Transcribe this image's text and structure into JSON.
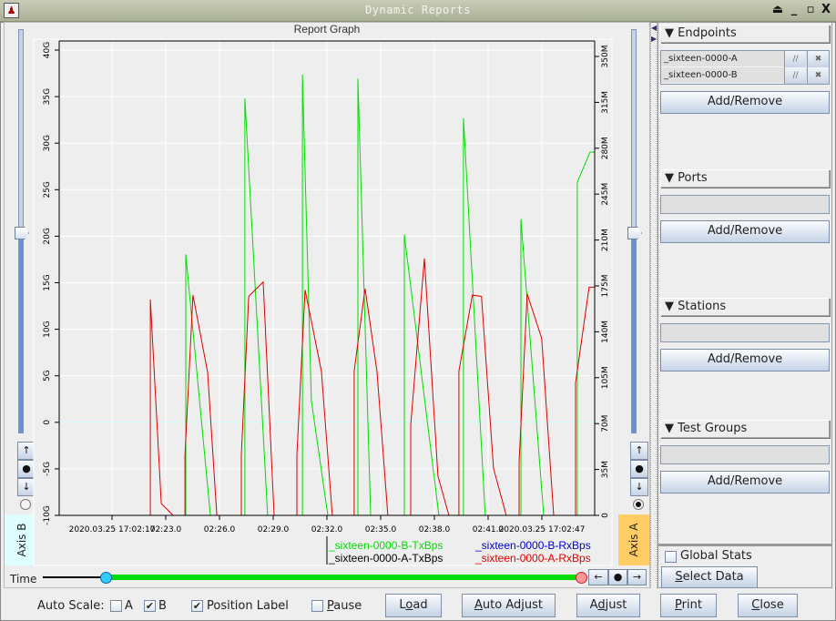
{
  "window": {
    "title": "Dynamic Reports"
  },
  "graph": {
    "title": "Report Graph",
    "axis_b_label": "Axis B",
    "axis_a_label": "Axis A",
    "axis_b_slider_value": 0.625,
    "axis_a_slider_value": 0.51,
    "axis_b_radio_selected": false,
    "axis_a_radio_selected": true,
    "scroll_up": "↑",
    "scroll_center": "●",
    "scroll_down": "↓"
  },
  "chart_data": {
    "type": "line",
    "title": "Report Graph",
    "xlabel": "",
    "left_axis": {
      "name": "Axis B",
      "ticks": [
        "-10G",
        "-5G",
        "0",
        "5G",
        "10G",
        "15G",
        "20G",
        "25G",
        "30G",
        "35G",
        "40G"
      ],
      "ylim": [
        -10,
        40
      ],
      "unit": "G"
    },
    "right_axis": {
      "name": "Axis A",
      "ticks": [
        "0",
        "35M",
        "70M",
        "105M",
        "140M",
        "175M",
        "210M",
        "245M",
        "280M",
        "315M",
        "350M"
      ],
      "ylim": [
        0,
        350
      ],
      "unit": "M"
    },
    "x_ticks": [
      {
        "t": 20,
        "label": "2020.03.25 17:02:17"
      },
      {
        "t": 23,
        "label": "02:23.0"
      },
      {
        "t": 26,
        "label": "02:26.0"
      },
      {
        "t": 29,
        "label": "02:29.0"
      },
      {
        "t": 32,
        "label": "02:32.0"
      },
      {
        "t": 35,
        "label": "02:35.0"
      },
      {
        "t": 38,
        "label": "02:38.0"
      },
      {
        "t": 41,
        "label": "02:41.0"
      },
      {
        "t": 44,
        "label": "2020.03.25 17:02:47"
      }
    ],
    "xlim": [
      17.05,
      46.95
    ],
    "grid": true,
    "legend_position": "bottom-right",
    "series": [
      {
        "name": "_sixteen-0000-B-TxBps",
        "color": "#00dd00",
        "axis": "right",
        "points": [
          [
            24.12,
            0
          ],
          [
            24.12,
            199
          ],
          [
            25.49,
            0
          ],
          [
            27.42,
            0
          ],
          [
            27.42,
            318
          ],
          [
            28.69,
            0
          ],
          [
            30.63,
            0
          ],
          [
            30.63,
            336
          ],
          [
            31.13,
            87.5
          ],
          [
            32.05,
            0
          ],
          [
            33.73,
            0
          ],
          [
            33.73,
            333
          ],
          [
            34.44,
            0
          ],
          [
            36.32,
            0
          ],
          [
            36.32,
            214
          ],
          [
            38.25,
            0
          ],
          [
            39.62,
            0
          ],
          [
            39.62,
            303
          ],
          [
            40.84,
            0
          ],
          [
            42.83,
            0
          ],
          [
            42.83,
            226
          ],
          [
            44.1,
            0
          ],
          [
            45.98,
            0
          ],
          [
            45.98,
            254
          ],
          [
            46.69,
            277
          ],
          [
            46.95,
            277
          ]
        ]
      },
      {
        "name": "_sixteen-0000-B-RxBps",
        "color": "#0000cc",
        "axis": "right",
        "points": []
      },
      {
        "name": "_sixteen-0000-A-TxBps",
        "color": "#000000",
        "axis": "right",
        "points": []
      },
      {
        "name": "_sixteen-0000-A-RxBps",
        "color": "#dd0000",
        "axis": "right",
        "points": [
          [
            22.14,
            0
          ],
          [
            22.14,
            164.6
          ],
          [
            22.75,
            9
          ],
          [
            23.41,
            0
          ],
          [
            24.07,
            0
          ],
          [
            24.07,
            45.8
          ],
          [
            24.52,
            168
          ],
          [
            25.34,
            109
          ],
          [
            25.85,
            0
          ],
          [
            27.22,
            0
          ],
          [
            27.22,
            45.8
          ],
          [
            27.63,
            167
          ],
          [
            28.44,
            178
          ],
          [
            29.05,
            0
          ],
          [
            30.32,
            0
          ],
          [
            30.32,
            45.8
          ],
          [
            30.78,
            172
          ],
          [
            31.69,
            110
          ],
          [
            32.3,
            0
          ],
          [
            33.52,
            0
          ],
          [
            33.52,
            110
          ],
          [
            34.13,
            173
          ],
          [
            34.79,
            110
          ],
          [
            35.4,
            0
          ],
          [
            36.68,
            0
          ],
          [
            36.68,
            69
          ],
          [
            37.44,
            196
          ],
          [
            38.2,
            30
          ],
          [
            38.81,
            0
          ],
          [
            39.37,
            0
          ],
          [
            39.37,
            110
          ],
          [
            40.12,
            168
          ],
          [
            40.63,
            167
          ],
          [
            41.3,
            36
          ],
          [
            42.01,
            0
          ],
          [
            42.73,
            0
          ],
          [
            42.73,
            40
          ],
          [
            43.18,
            169
          ],
          [
            43.99,
            135
          ],
          [
            44.66,
            0
          ],
          [
            45.88,
            0
          ],
          [
            45.88,
            101
          ],
          [
            46.64,
            174
          ],
          [
            46.95,
            174
          ]
        ]
      }
    ]
  },
  "time": {
    "label": "Time",
    "start_fraction": 0.1,
    "end_fraction": 1.0,
    "left": "←",
    "center": "●",
    "right": "→"
  },
  "panel": {
    "sections": [
      {
        "title": "▼ Endpoints",
        "items": [
          {
            "name": "_sixteen-0000-A",
            "pause": "//",
            "remove": "✖"
          },
          {
            "name": "_sixteen-0000-B",
            "pause": "//",
            "remove": "✖"
          }
        ],
        "button": "Add/Remove"
      },
      {
        "title": "▼ Ports",
        "items": [],
        "button": "Add/Remove"
      },
      {
        "title": "▼ Stations",
        "items": [],
        "button": "Add/Remove"
      },
      {
        "title": "▼ Test Groups",
        "items": [],
        "button": "Add/Remove"
      }
    ],
    "global_stats": {
      "label": "Global Stats",
      "checked": false
    },
    "select_data": {
      "pre": "",
      "u": "S",
      "post": "elect Data"
    }
  },
  "bottom": {
    "auto_scale_label": "Auto Scale:",
    "a": {
      "label": "A",
      "checked": false
    },
    "b": {
      "label": "B",
      "checked": true
    },
    "position_label": {
      "label": "Position Label",
      "checked": true
    },
    "pause": {
      "u": "P",
      "post": "ause",
      "checked": false
    },
    "load": {
      "pre": "L",
      "u": "o",
      "post": "ad"
    },
    "auto_adjust": {
      "pre": "",
      "u": "A",
      "post": "uto Adjust"
    },
    "adjust": {
      "pre": "A",
      "u": "d",
      "post": "just"
    },
    "print": {
      "pre": "",
      "u": "P",
      "post": "rint"
    },
    "close": {
      "pre": "",
      "u": "C",
      "post": "lose"
    }
  }
}
